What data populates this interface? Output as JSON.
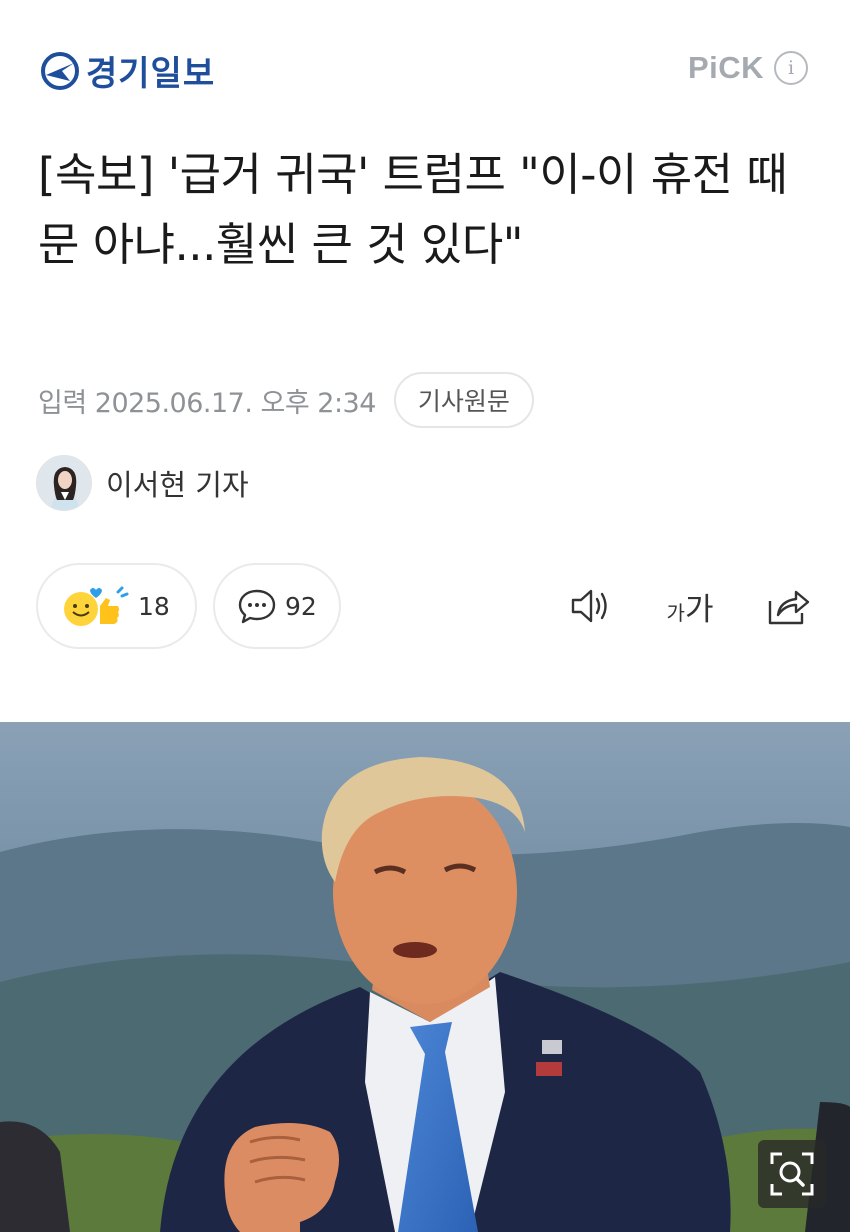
{
  "header": {
    "logo_text": "경기일보",
    "pick_label": "PiCK",
    "info_glyph": "i"
  },
  "article": {
    "title": "[속보] '급거 귀국' 트럼프 \"이-이 휴전 때문 아냐...훨씬 큰 것 있다\"",
    "date": "입력 2025.06.17. 오후 2:34",
    "original_button": "기사원문",
    "reporter": "이서현 기자"
  },
  "actions": {
    "like_count": "18",
    "comment_count": "92",
    "font_small": "가",
    "font_big": "가"
  },
  "icons": [
    "logo-icon",
    "info-icon",
    "reaction-icon",
    "comment-icon",
    "speaker-icon",
    "font-size-icon",
    "share-icon",
    "zoom-icon"
  ],
  "colors": {
    "brand": "#1f4e9c",
    "pick_gray": "#a5aab0",
    "meta_gray": "#8e9297"
  }
}
